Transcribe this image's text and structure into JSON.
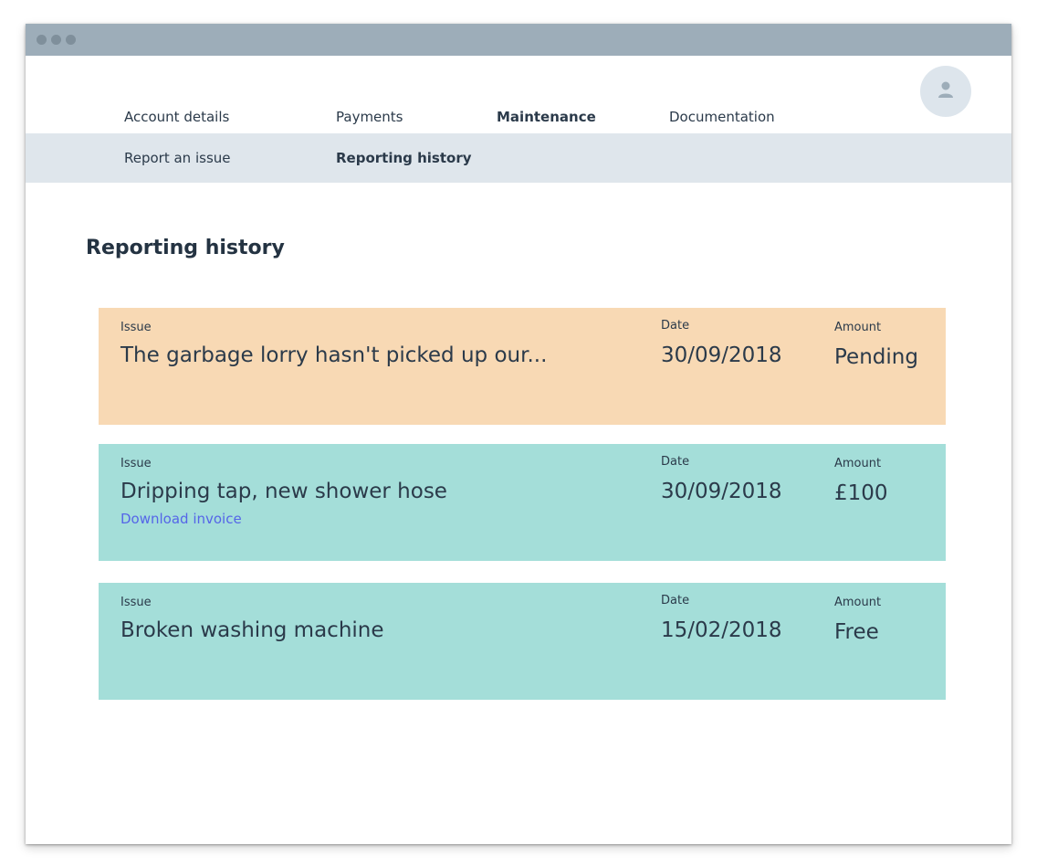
{
  "top_nav": [
    {
      "label": "Account details",
      "active": false
    },
    {
      "label": "Payments",
      "active": false
    },
    {
      "label": "Maintenance",
      "active": true
    },
    {
      "label": "Documentation",
      "active": false
    }
  ],
  "sub_nav": [
    {
      "label": "Report an issue",
      "active": false
    },
    {
      "label": "Reporting history",
      "active": true
    }
  ],
  "page_title": "Reporting history",
  "columns": {
    "issue": "Issue",
    "date": "Date",
    "amount": "Amount"
  },
  "reports": [
    {
      "issue": "The garbage lorry hasn't picked up our...",
      "date": "30/09/2018",
      "amount": "Pending",
      "link": "",
      "status_color": "#f8d9b4"
    },
    {
      "issue": "Dripping tap, new shower hose",
      "date": "30/09/2018",
      "amount": "£100",
      "link": "Download invoice",
      "status_color": "#a4ded9"
    },
    {
      "issue": "Broken washing machine",
      "date": "15/02/2018",
      "amount": "Free",
      "link": "",
      "status_color": "#a4ded9"
    }
  ],
  "icons": {
    "avatar": "user-icon"
  },
  "colors": {
    "titlebar": "#9dadb9",
    "subnav": "#dfe6ec",
    "link": "#5565e8",
    "pending": "#f8d9b4",
    "complete": "#a4ded9"
  }
}
